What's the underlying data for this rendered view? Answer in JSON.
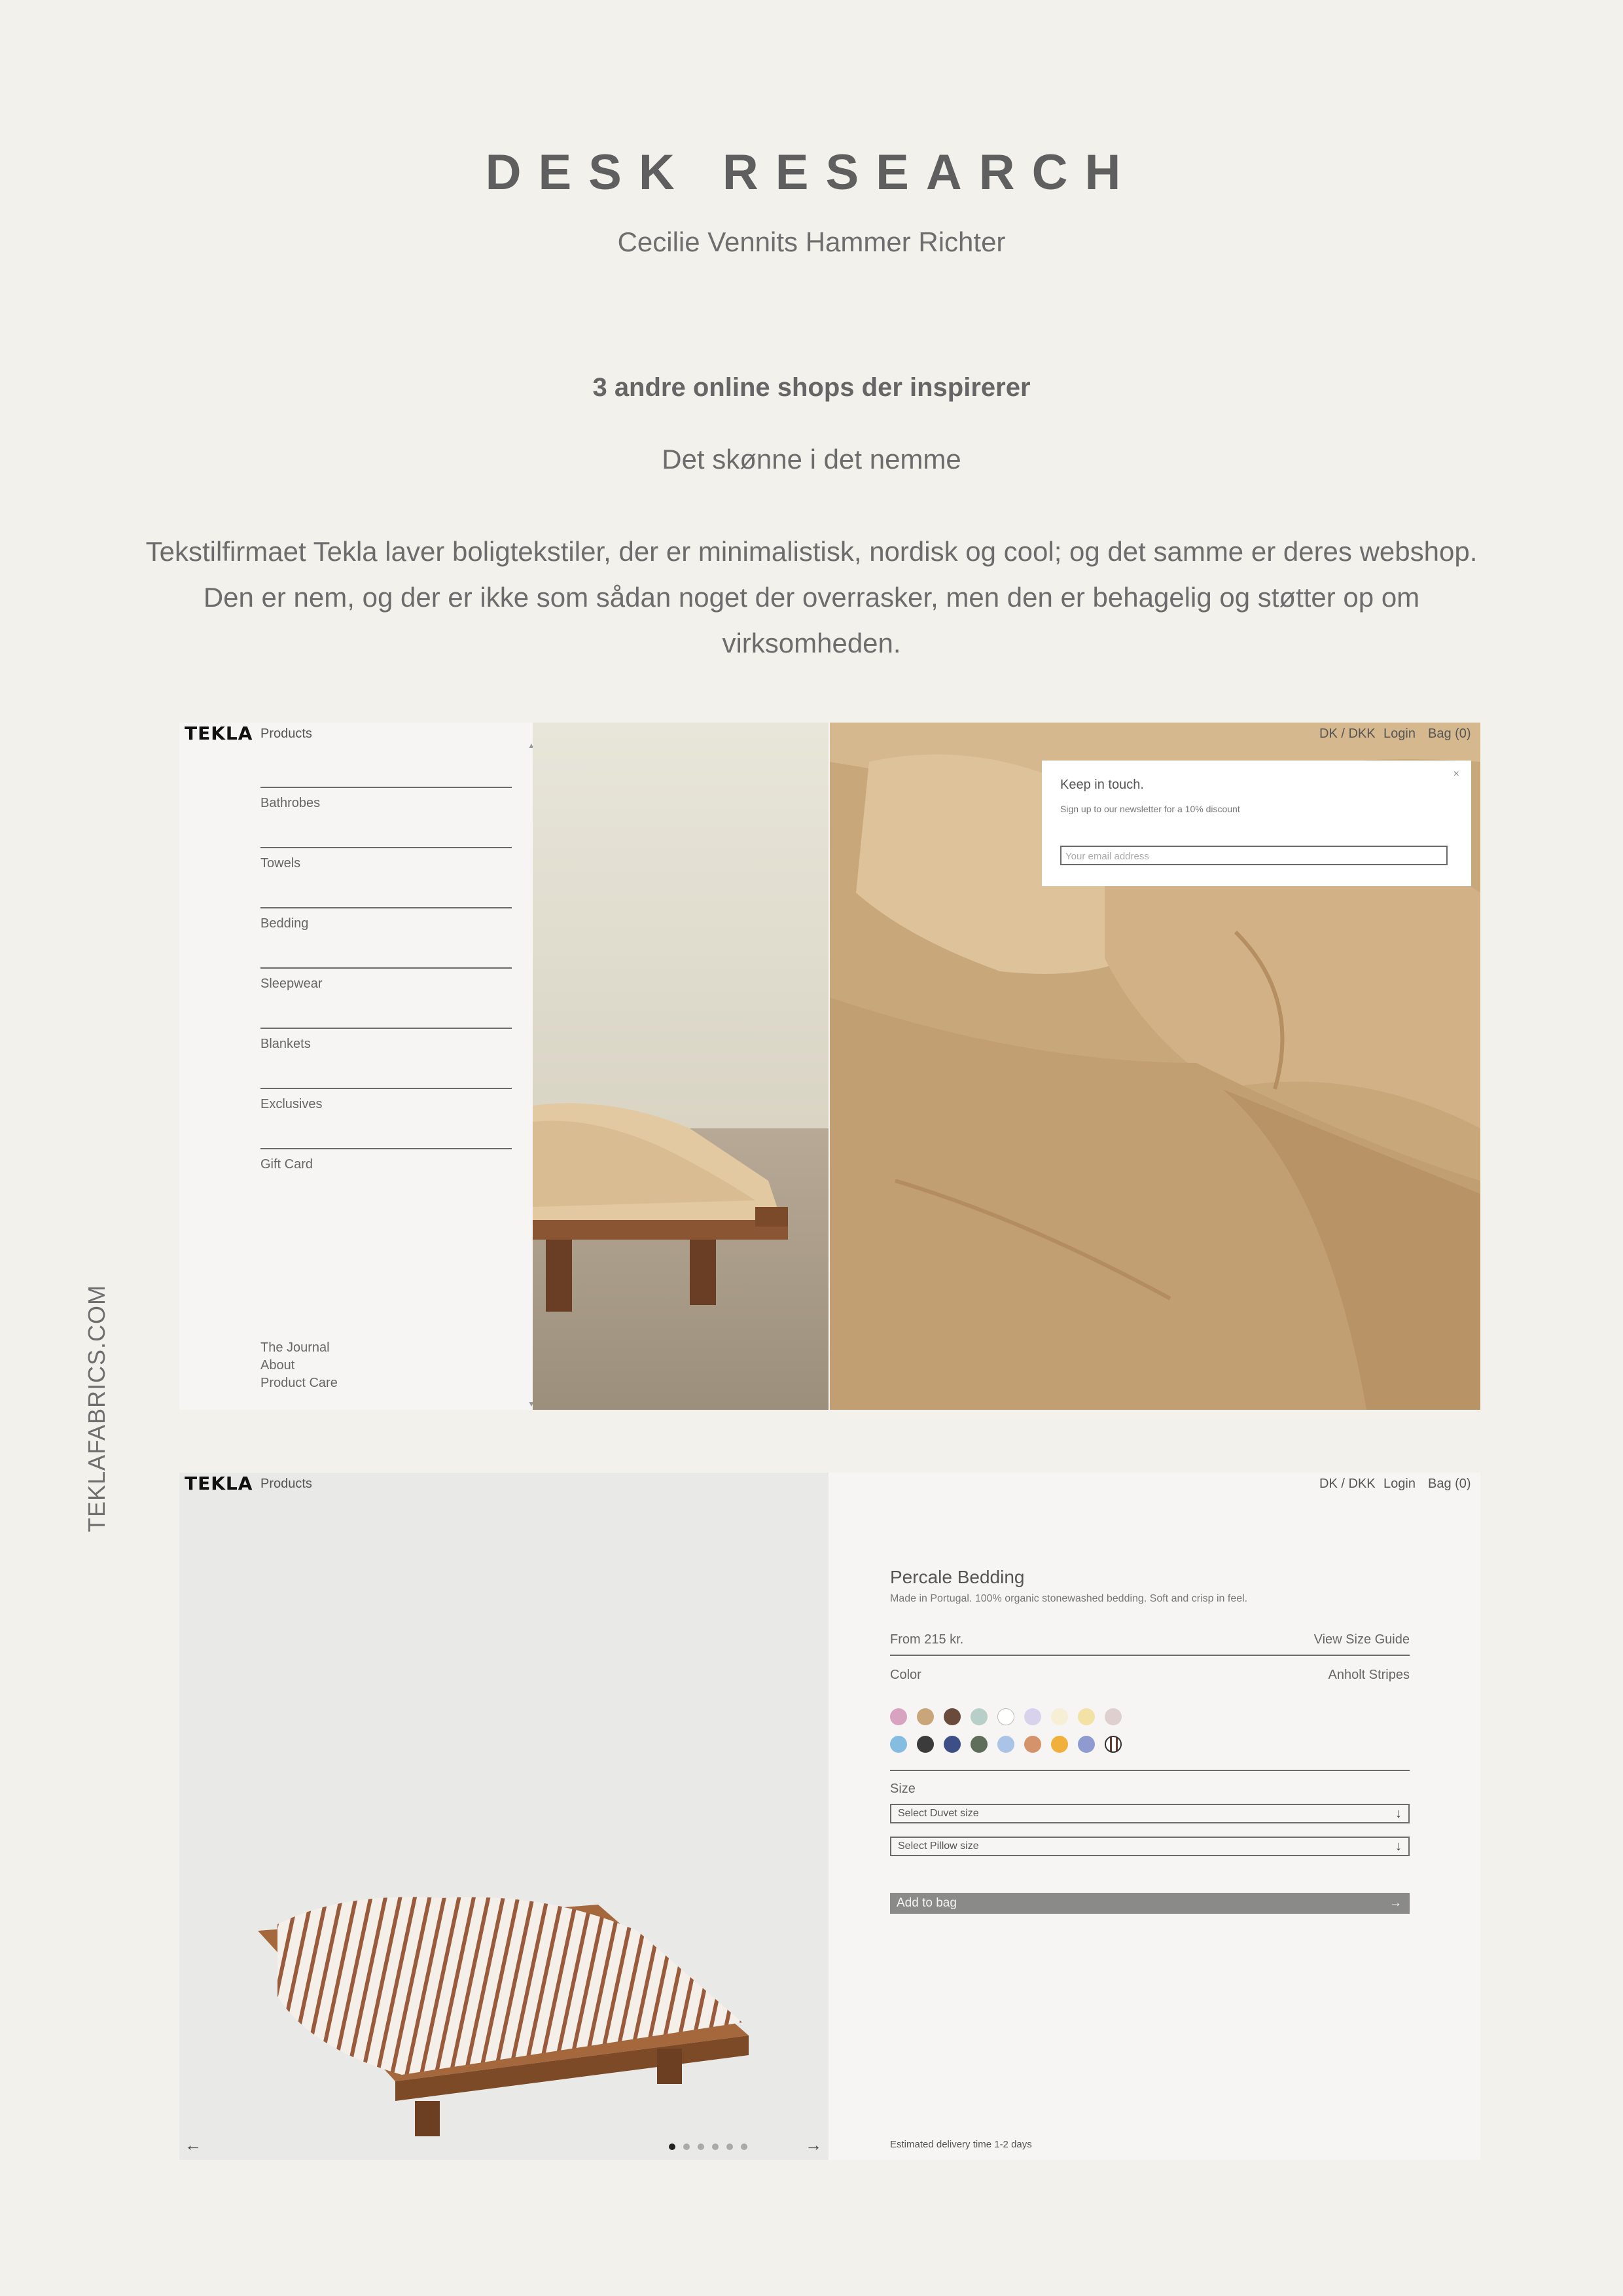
{
  "document": {
    "title": "DESK RESEARCH",
    "author": "Cecilie Vennits Hammer Richter",
    "subheading": "3 andre online shops der inspirerer",
    "tagline": "Det skønne i det nemme",
    "intro": "Tekstilfirmaet Tekla laver boligtekstiler, der er minimalistisk, nordisk og cool; og det samme er deres webshop. Den er nem, og der er ikke som sådan noget der overrasker, men den er behagelig og støtter op om virksomheden.",
    "side_label": "TEKLAFABRICS.COM"
  },
  "site": {
    "logo": "TEKLA",
    "products_link": "Products",
    "currency": "DK / DKK",
    "login": "Login",
    "bag": "Bag (0)"
  },
  "screenshot1": {
    "categories": [
      "Bathrobes",
      "Towels",
      "Bedding",
      "Sleepwear",
      "Blankets",
      "Exclusives",
      "Gift Card"
    ],
    "footer_links": [
      "The Journal",
      "About",
      "Product Care"
    ],
    "popup": {
      "title": "Keep in touch.",
      "text": "Sign up to our newsletter for a 10% discount",
      "close": "×",
      "email_placeholder": "Your email address"
    }
  },
  "screenshot2": {
    "product_title": "Percale Bedding",
    "product_desc": "Made in Portugal. 100% organic stonewashed bedding. Soft and crisp in feel.",
    "price": "From 215 kr.",
    "size_guide": "View Size Guide",
    "color_label": "Color",
    "color_value": "Anholt Stripes",
    "swatches_row1": [
      "#d8a3c0",
      "#c9a57a",
      "#6a4a3a",
      "#b7cfc8",
      "#ffffff",
      "#d9d2ec",
      "#f7eed6",
      "#f2e2a6",
      "#dfd0d0"
    ],
    "swatches_row2": [
      "#84bde0",
      "#3b3b3b",
      "#3d4f86",
      "#5e6e5a",
      "#a9c4e6",
      "#d4936a",
      "#f0b03c",
      "#8f9bd0",
      "#ffffff"
    ],
    "size_label": "Size",
    "duvet_select": "Select Duvet size",
    "pillow_select": "Select Pillow size",
    "add_to_bag": "Add to bag",
    "delivery": "Estimated delivery time 1-2 days",
    "carousel_dots": 6,
    "active_dot": 0
  }
}
